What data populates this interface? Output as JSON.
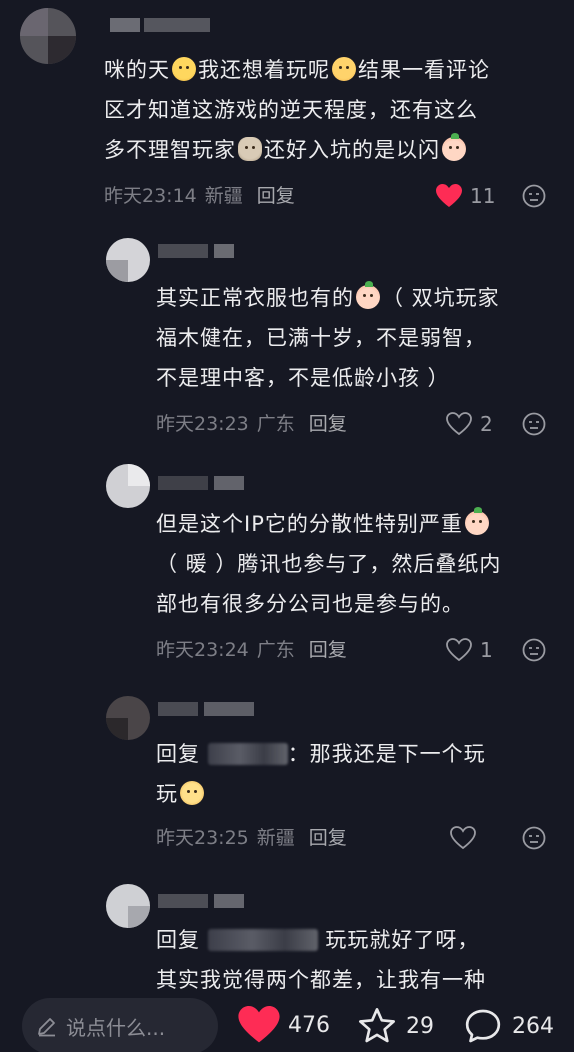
{
  "colors": {
    "background": "#161823",
    "liked_heart": "#fe2c55",
    "meta_text": "#7d7e86"
  },
  "comments": [
    {
      "body_line1": "咪的天",
      "body_line1b": "我还想着玩呢",
      "body_line1c": "结果一看评论",
      "body_line2": "区才知道这游戏的逆天程度，还有这么",
      "body_line3a": "多不理智玩家",
      "body_line3b": "还好入坑的是以闪",
      "time": "昨天23:14",
      "location": "新疆",
      "reply_label": "回复",
      "likes": "11",
      "liked": true
    },
    {
      "body_line1": "其实正常衣服也有的",
      "body_line1b": "（ 双坑玩家",
      "body_line2": "福木健在，已满十岁，不是弱智，",
      "body_line3": "不是理中客，不是低龄小孩 ）",
      "time": "昨天23:23",
      "location": "广东",
      "reply_label": "回复",
      "likes": "2",
      "liked": false
    },
    {
      "body_line1": "但是这个IP它的分散性特别严重",
      "body_line2": "（ 暖 ）腾讯也参与了，然后叠纸内",
      "body_line3": "部也有很多分公司也是参与的。",
      "time": "昨天23:24",
      "location": "广东",
      "reply_label": "回复",
      "likes": "1",
      "liked": false
    },
    {
      "reply_prefix": "回复",
      "body_line1": "：那我还是下一个玩",
      "body_line2": "玩",
      "time": "昨天23:25",
      "location": "新疆",
      "reply_label": "回复",
      "likes": "",
      "liked": false
    },
    {
      "reply_prefix": "回复",
      "body_line1": "玩玩就好了呀，",
      "body_line2": "其实我觉得两个都差，让我有一种"
    }
  ],
  "bottom": {
    "input_placeholder": "说点什么...",
    "likes": "476",
    "favorites": "29",
    "comments": "264"
  }
}
